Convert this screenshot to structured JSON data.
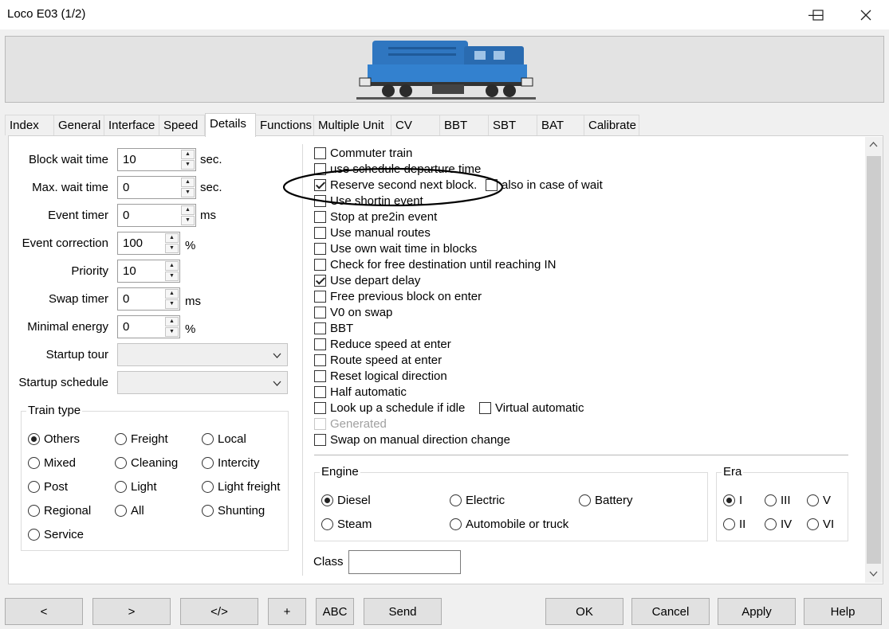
{
  "window": {
    "title": "Loco E03 (1/2)",
    "minimize_glyph": "—",
    "maximize_glyph": "☐",
    "close_glyph": "✕"
  },
  "tabs": [
    {
      "label": "Index"
    },
    {
      "label": "General"
    },
    {
      "label": "Interface"
    },
    {
      "label": "Speed"
    },
    {
      "label": "Details",
      "active": true
    },
    {
      "label": "Functions"
    },
    {
      "label": "Multiple Unit"
    },
    {
      "label": "CV"
    },
    {
      "label": "BBT"
    },
    {
      "label": "SBT"
    },
    {
      "label": "BAT"
    },
    {
      "label": "Calibrate"
    }
  ],
  "fields": {
    "block_wait_time": {
      "label": "Block wait time",
      "value": "10",
      "unit": "sec."
    },
    "max_wait_time": {
      "label": "Max. wait time",
      "value": "0",
      "unit": "sec."
    },
    "event_timer": {
      "label": "Event timer",
      "value": "0",
      "unit": "ms"
    },
    "event_correction": {
      "label": "Event correction",
      "value": "100",
      "unit": "%"
    },
    "priority": {
      "label": "Priority",
      "value": "10"
    },
    "swap_timer": {
      "label": "Swap timer",
      "value": "0",
      "unit": "ms"
    },
    "minimal_energy": {
      "label": "Minimal energy",
      "value": "0",
      "unit": "%"
    },
    "startup_tour": {
      "label": "Startup tour",
      "value": ""
    },
    "startup_schedule": {
      "label": "Startup schedule",
      "value": ""
    }
  },
  "train_type": {
    "title": "Train type",
    "options": [
      "Others",
      "Freight",
      "Local",
      "Mixed",
      "Cleaning",
      "Intercity",
      "Post",
      "Light",
      "Light freight",
      "Regional",
      "All",
      "Shunting",
      "Service"
    ],
    "selected": "Others"
  },
  "checks": {
    "commuter_train": {
      "label": "Commuter train",
      "checked": false
    },
    "use_schedule_departure_time": {
      "label": "use schedule departure time",
      "checked": false
    },
    "reserve_second_next_block": {
      "label": "Reserve second next block.",
      "checked": true
    },
    "also_in_case_of_wait": {
      "label": "also in case of wait",
      "checked": false
    },
    "use_shortin_event": {
      "label": "Use shortin event",
      "checked": false
    },
    "stop_at_pre2in_event": {
      "label": "Stop at pre2in event",
      "checked": false
    },
    "use_manual_routes": {
      "label": "Use manual routes",
      "checked": false
    },
    "use_own_wait_time_in_blocks": {
      "label": "Use own wait time in blocks",
      "checked": false
    },
    "check_for_free_destination": {
      "label": "Check for free destination until reaching IN",
      "checked": false
    },
    "use_depart_delay": {
      "label": "Use depart delay",
      "checked": true
    },
    "free_previous_block_on_enter": {
      "label": "Free previous block on enter",
      "checked": false
    },
    "v0_on_swap": {
      "label": "V0 on swap",
      "checked": false
    },
    "bbt": {
      "label": "BBT",
      "checked": false
    },
    "reduce_speed_at_enter": {
      "label": "Reduce speed at enter",
      "checked": false
    },
    "route_speed_at_enter": {
      "label": "Route speed at enter",
      "checked": false
    },
    "reset_logical_direction": {
      "label": "Reset logical direction",
      "checked": false
    },
    "half_automatic": {
      "label": "Half automatic",
      "checked": false
    },
    "look_up_a_schedule_if_idle": {
      "label": "Look up a schedule if idle",
      "checked": false
    },
    "virtual_automatic": {
      "label": "Virtual automatic",
      "checked": false
    },
    "generated": {
      "label": "Generated",
      "checked": false,
      "disabled": true
    },
    "swap_on_manual_direction_change": {
      "label": "Swap on manual direction change",
      "checked": false
    }
  },
  "engine": {
    "title": "Engine",
    "options": [
      "Diesel",
      "Electric",
      "Battery",
      "Steam",
      "Automobile or truck"
    ],
    "selected": "Diesel"
  },
  "era": {
    "title": "Era",
    "options": [
      "I",
      "III",
      "V",
      "II",
      "IV",
      "VI"
    ],
    "selected": "I"
  },
  "class_field": {
    "label": "Class",
    "value": ""
  },
  "buttons": {
    "prev": "<",
    "next": ">",
    "xml": "</>",
    "add": "+",
    "abc": "ABC",
    "send": "Send",
    "ok": "OK",
    "cancel": "Cancel",
    "apply": "Apply",
    "help": "Help"
  },
  "colors": {
    "locomotive_body": "#2f76c0",
    "annotation_ellipse": "#000000"
  }
}
